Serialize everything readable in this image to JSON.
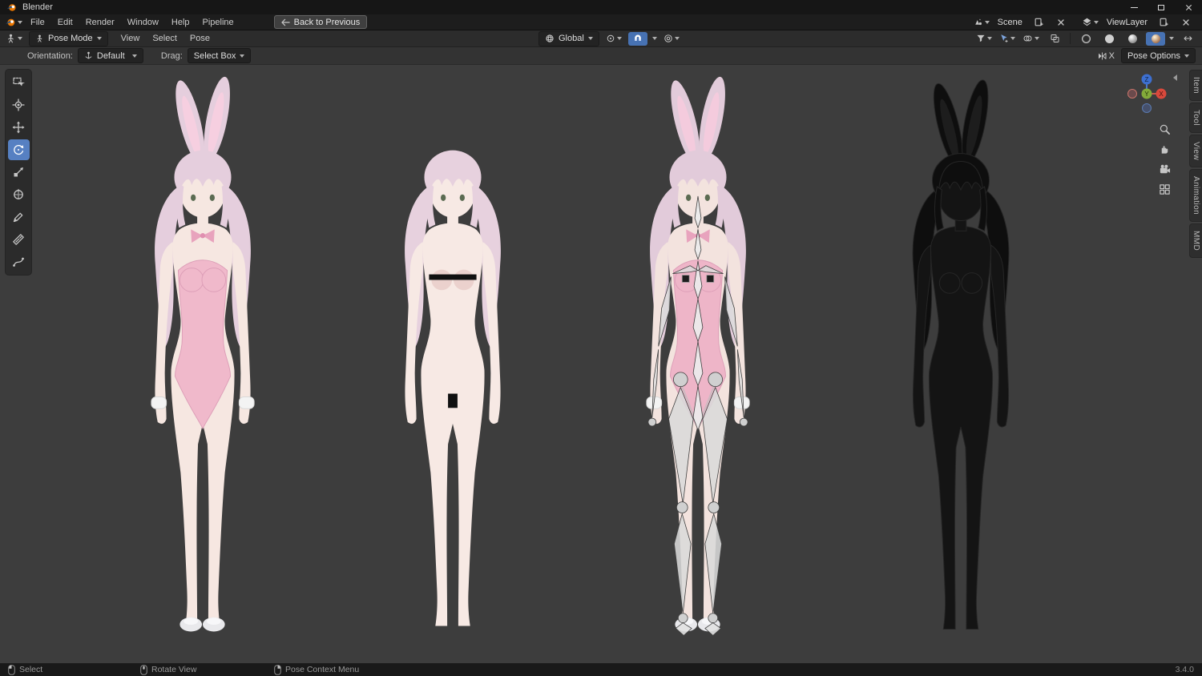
{
  "window": {
    "title": "Blender"
  },
  "menubar": {
    "items": [
      "File",
      "Edit",
      "Render",
      "Window",
      "Help",
      "Pipeline"
    ],
    "back_button": "Back to Previous",
    "scene_label": "Scene",
    "viewlayer_label": "ViewLayer"
  },
  "toolheader": {
    "mode": "Pose Mode",
    "menus": [
      "View",
      "Select",
      "Pose"
    ],
    "orientation": "Global"
  },
  "subheader": {
    "orientation_label": "Orientation:",
    "orientation_value": "Default",
    "drag_label": "Drag:",
    "drag_value": "Select Box",
    "mirror_label": "X",
    "pose_options_label": "Pose Options"
  },
  "sidebar": {
    "tabs": [
      "Item",
      "Tool",
      "View",
      "Animation",
      "MMD"
    ]
  },
  "gizmo": {
    "x": "X",
    "y": "Y",
    "z": "Z"
  },
  "statusbar": {
    "select": "Select",
    "rotate_view": "Rotate View",
    "pose_context_menu": "Pose Context Menu",
    "version": "3.4.0"
  },
  "viewport": {
    "models": [
      {
        "name": "girl-bunny-suit"
      },
      {
        "name": "girl-nude-censored"
      },
      {
        "name": "girl-armature-overlay"
      },
      {
        "name": "girl-wireframe"
      }
    ]
  },
  "colors": {
    "accent_blue": "#4772b3",
    "tool_active_blue": "#5680c2",
    "viewport_bg": "#3d3d3d",
    "suit_pink": "#f0b9cb",
    "hair_pink": "#e5cedd",
    "skin": "#f6e7e1",
    "censor_black": "#101010",
    "bone_gray": "#dcdcdc"
  }
}
